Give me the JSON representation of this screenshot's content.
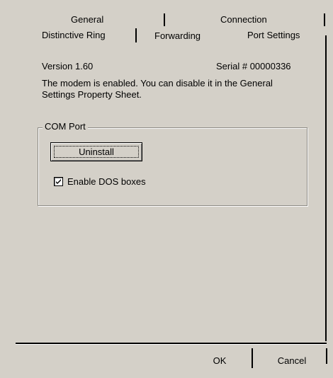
{
  "tabs": {
    "row1": [
      "General",
      "Connection"
    ],
    "row2": [
      "Distinctive Ring",
      "Forwarding",
      "Port Settings"
    ],
    "selected": "Port Settings"
  },
  "info": {
    "version": "Version 1.60",
    "serial": "Serial # 00000336",
    "message_line1": "The modem is enabled. You can disable it in the General",
    "message_line2": "Settings Property Sheet."
  },
  "com_port": {
    "title": "COM Port",
    "uninstall_label": "Uninstall",
    "checkbox_label": "Enable DOS boxes",
    "checkbox_checked": true
  },
  "footer": {
    "ok_label": "OK",
    "cancel_label": "Cancel"
  },
  "colors": {
    "face": "#d4d0c8",
    "text": "#000000",
    "shadow": "#808080",
    "highlight": "#ffffff"
  }
}
